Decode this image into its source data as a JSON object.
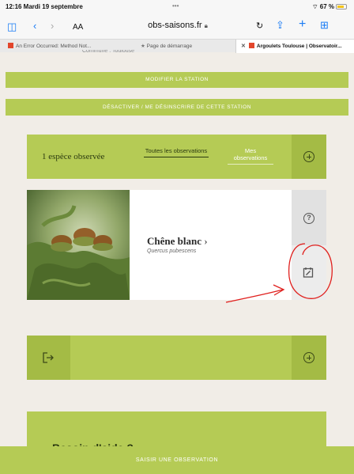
{
  "statusbar": {
    "time_date": "12:16  Mardi 19 septembre",
    "dots": "•••",
    "battery": "67 %"
  },
  "browser": {
    "address": "obs-saisons.fr",
    "reader_label": "AA",
    "tabs": [
      {
        "label": "An Error Occurred: Method Not..."
      },
      {
        "label": "Page de démarrage"
      },
      {
        "label": "Argoulets Toulouse | Observatoir..."
      }
    ]
  },
  "page": {
    "cut_text": "Commune : Toulouse",
    "modify_station": "MODIFIER LA STATION",
    "deactivate_station": "DÉSACTIVER / ME DÉSINSCRIRE DE CETTE STATION",
    "species_count": "1 espèce observée",
    "filter_tabs": [
      {
        "label": "Toutes les observations"
      },
      {
        "label": "Mes observations"
      }
    ],
    "species": {
      "name": "Chêne blanc",
      "latin": "Quercus pubescens"
    },
    "cut_heading": "Besoin d'aide ?",
    "add_observation": "SAISIR UNE OBSERVATION"
  },
  "colors": {
    "accent": "#b5cb55",
    "dark_green": "#3c4a18",
    "annotation": "#e0201e"
  }
}
